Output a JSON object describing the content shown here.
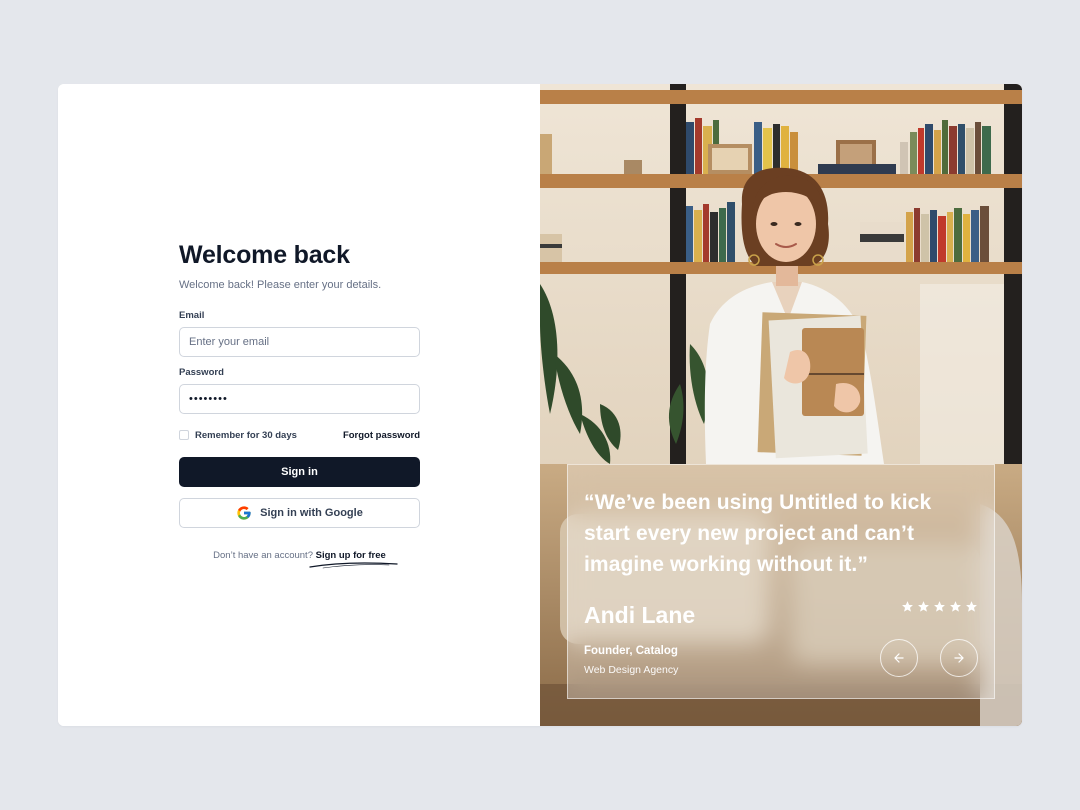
{
  "login": {
    "title": "Welcome back",
    "subtitle": "Welcome back! Please enter your details.",
    "email": {
      "label": "Email",
      "placeholder": "Enter your email",
      "value": ""
    },
    "password": {
      "label": "Password",
      "value": "••••••••"
    },
    "remember_label": "Remember for 30 days",
    "remember_checked": false,
    "forgot_label": "Forgot password",
    "signin_label": "Sign in",
    "google_label": "Sign in with Google",
    "signup_prompt": "Don’t have an account?",
    "signup_link": "Sign up for free"
  },
  "testimonial": {
    "quote": "“We’ve been using Untitled to kick start every new project and can’t imagine working without it.”",
    "author": "Andi Lane",
    "role": "Founder, Catalog",
    "company": "Web Design Agency",
    "rating": 5
  },
  "icons": {
    "google": "google-icon",
    "star": "star-icon",
    "prev": "arrow-left-icon",
    "next": "arrow-right-icon"
  },
  "colors": {
    "background": "#e4e7ec",
    "primary_button": "#101828",
    "text_primary": "#101828",
    "text_secondary": "#667085",
    "border": "#d0d5dd"
  }
}
